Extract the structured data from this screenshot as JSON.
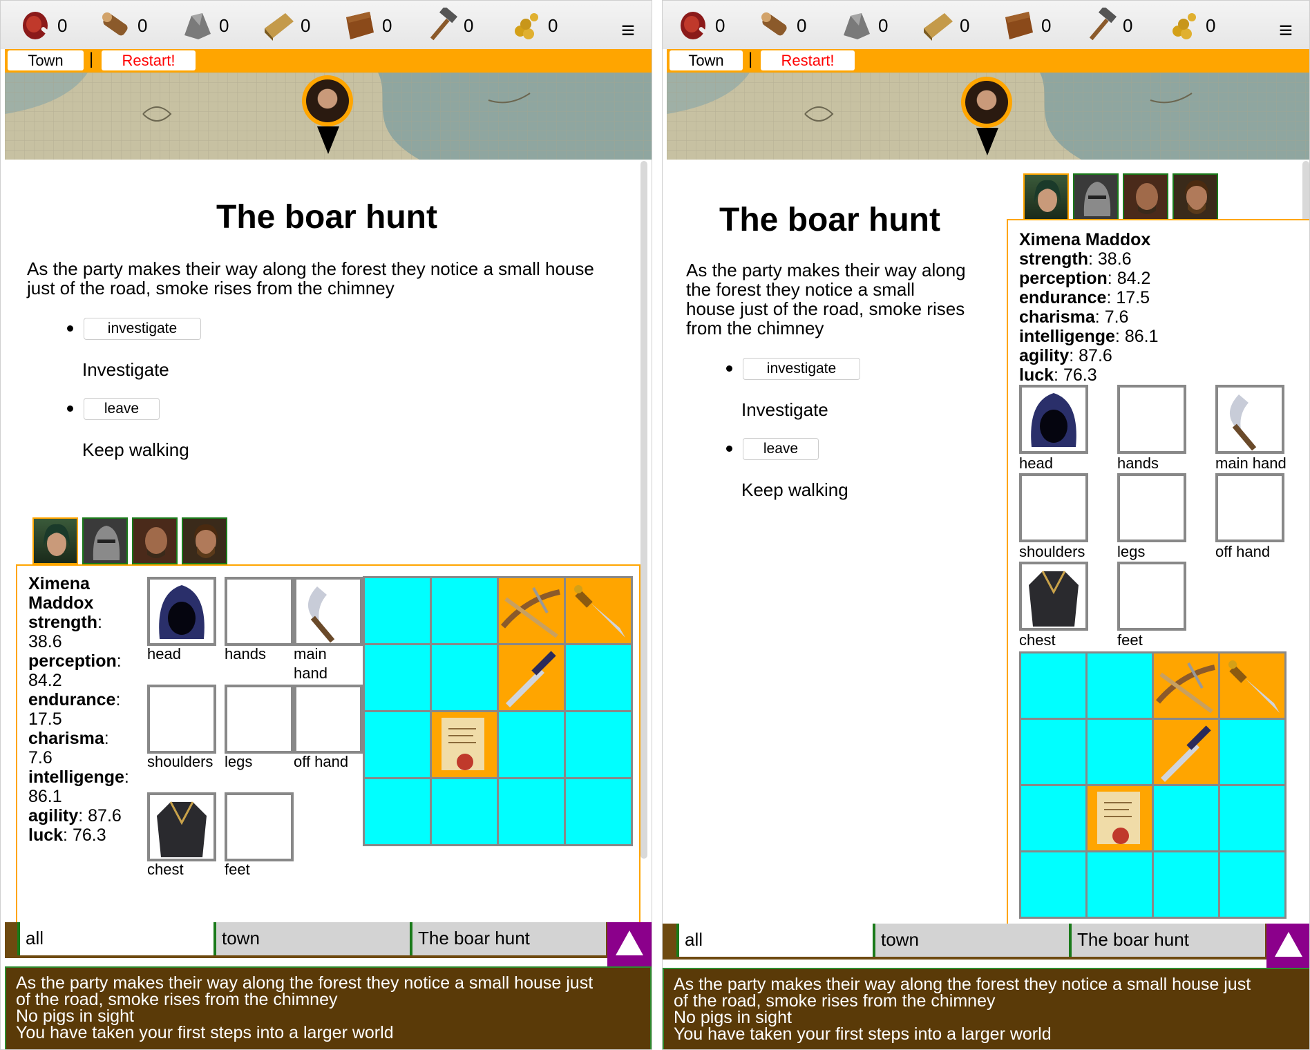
{
  "resources": [
    {
      "icon": "meat-icon",
      "count": "0"
    },
    {
      "icon": "wood-log-icon",
      "count": "0"
    },
    {
      "icon": "stone-icon",
      "count": "0"
    },
    {
      "icon": "wood-plank-icon",
      "count": "0"
    },
    {
      "icon": "leather-icon",
      "count": "0"
    },
    {
      "icon": "hammer-icon",
      "count": "0"
    },
    {
      "icon": "coins-icon",
      "count": "0"
    }
  ],
  "nav": {
    "town": "Town",
    "separator": "|",
    "restart": "Restart!"
  },
  "event": {
    "title": "The boar hunt",
    "desc_left_1": "As the party makes their way along the forest they notice a small house",
    "desc_left_2": "just of the road, smoke rises from the chimney",
    "desc_right_1": "As the party makes their way along",
    "desc_right_2": "the forest they notice a small",
    "desc_right_3": "house just of the road, smoke rises",
    "desc_right_4": "from the chimney",
    "choices": [
      {
        "button": "investigate",
        "text": "Investigate"
      },
      {
        "button": "leave",
        "text": "Keep walking"
      }
    ]
  },
  "character": {
    "first_name": "Ximena",
    "last_name": "Maddox",
    "full_name": "Ximena Maddox",
    "stats": [
      {
        "name": "strength",
        "value": "38.6"
      },
      {
        "name": "perception",
        "value": "84.2"
      },
      {
        "name": "endurance",
        "value": "17.5"
      },
      {
        "name": "charisma",
        "value": "7.6"
      },
      {
        "name": "intelligenge",
        "value": "86.1"
      },
      {
        "name": "agility",
        "value": "87.6"
      },
      {
        "name": "luck",
        "value": "76.3"
      }
    ],
    "slots": {
      "head": "head",
      "hands": "hands",
      "main_hand_1": "main",
      "main_hand_2": "hand",
      "main_hand": "main hand",
      "shoulders": "shoulders",
      "legs": "legs",
      "off_hand": "off hand",
      "chest": "chest",
      "feet": "feet"
    }
  },
  "log_tabs": [
    "all",
    "town",
    "The boar hunt"
  ],
  "log": [
    "As the party makes their way along the forest they notice a small house just",
    "of the road, smoke rises from the chimney",
    "No pigs in sight",
    "You have taken your first steps into a larger world"
  ],
  "colors": {
    "accent": "#ffa500",
    "inventory_empty": "#00ffff",
    "log_bg": "#5a3a08",
    "up_button": "#8b008b",
    "restart_text": "#ff0000"
  }
}
